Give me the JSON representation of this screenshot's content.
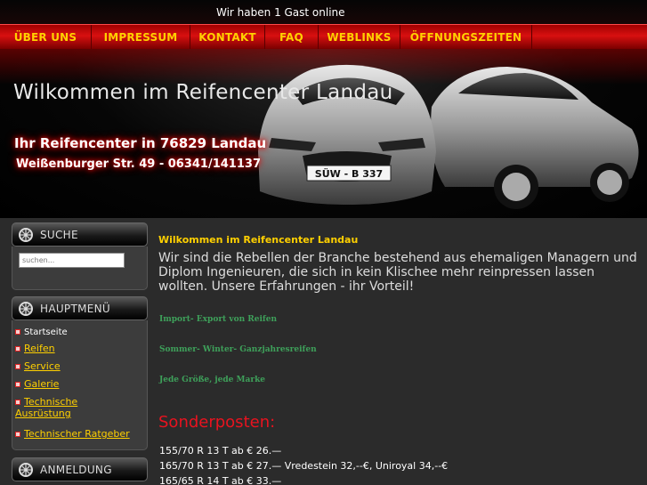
{
  "topbar": {
    "online_text": "Wir haben 1 Gast online"
  },
  "nav": {
    "items": [
      {
        "label": "ÜBER UNS"
      },
      {
        "label": "IMPRESSUM"
      },
      {
        "label": "KONTAKT"
      },
      {
        "label": "FAQ"
      },
      {
        "label": "WEBLINKS"
      },
      {
        "label": "ÖFFNUNGSZEITEN"
      }
    ]
  },
  "header": {
    "title": "Wilkommen im Reifencenter Landau",
    "subtitle_line1": "Ihr Reifencenter in 76829 Landau",
    "subtitle_line2": "Weißenburger Str. 49 - 06341/141137",
    "license_plate": "SÜW - B 337"
  },
  "sidebar": {
    "search": {
      "title": "SUCHE",
      "placeholder": "suchen..."
    },
    "menu": {
      "title": "HAUPTMENÜ",
      "items": [
        {
          "label": "Startseite"
        },
        {
          "label": "Reifen"
        },
        {
          "label": "Service"
        },
        {
          "label": "Galerie"
        },
        {
          "label": "Technische"
        },
        {
          "label": "Ausrüstung"
        },
        {
          "label": "Technischer Ratgeber"
        }
      ]
    },
    "login": {
      "title": "ANMELDUNG"
    }
  },
  "content": {
    "title": "Wilkommen im Reifencenter Landau",
    "intro": "Wir sind die Rebellen der Branche bestehend aus ehemaligen Managern und Diplom Ingenieuren, die sich in kein Klischee mehr reinpressen lassen wollten. Unsere Erfahrungen - ihr Vorteil!",
    "features": [
      "Import- Export von Reifen",
      "Sommer- Winter- Ganzjahresreifen",
      "Jede Größe, jede Marke"
    ],
    "sonder_title": "Sonderposten:",
    "prices": [
      "155/70 R 13 T  ab  €  26.—",
      "165/70 R 13 T  ab  €  27.— Vredestein 32,--€, Uniroyal 34,--€",
      "165/65 R 14 T  ab  €  33.—"
    ]
  },
  "colors": {
    "accent": "#ffd000",
    "nav_red": "#d81010",
    "sonder_red": "#e8131f",
    "feature_green": "#3ea05a"
  }
}
